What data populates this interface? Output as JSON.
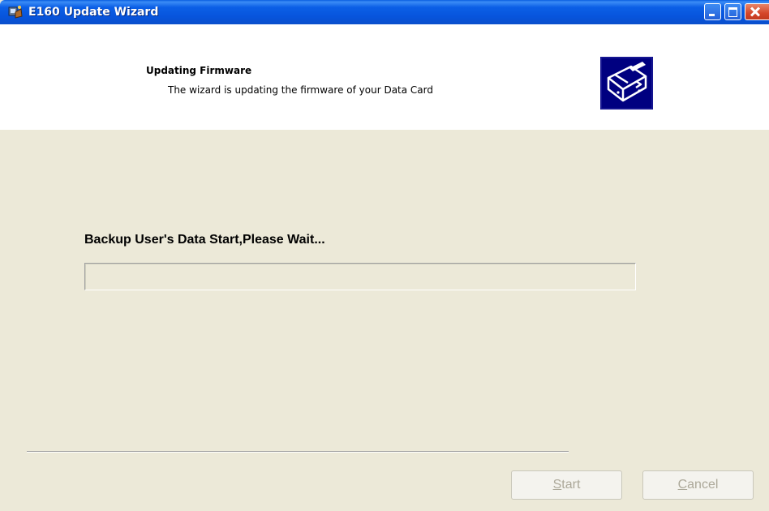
{
  "window": {
    "title": "E160 Update Wizard",
    "title_icon": "wizard-installer-icon",
    "controls": {
      "minimize_icon": "minimize-icon",
      "maximize_icon": "maximize-icon",
      "close_icon": "close-icon"
    }
  },
  "header": {
    "title": "Updating Firmware",
    "subtitle": "The wizard is updating the firmware of your Data Card",
    "image_icon": "firmware-device-icon"
  },
  "body": {
    "status": "Backup User's Data Start,Please Wait...",
    "progress": 0
  },
  "buttons": {
    "start": {
      "mnemonic": "S",
      "rest": "tart",
      "enabled": false
    },
    "cancel": {
      "mnemonic": "C",
      "rest": "ancel",
      "enabled": false
    }
  },
  "colors": {
    "titlebar": "#0754dc",
    "face": "#ece9d8",
    "header_bg": "#ffffff",
    "disabled_text": "#aca899",
    "close_button": "#d4462a"
  }
}
